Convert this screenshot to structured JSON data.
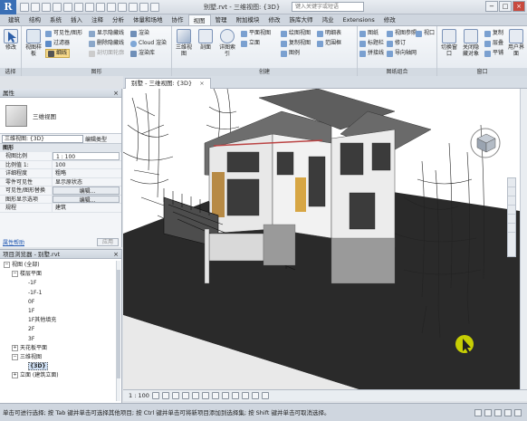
{
  "titlebar": {
    "logo": "R",
    "document_title": "别墅.rvt - 三维视图: {3D}",
    "search_placeholder": "键入关键字或短语",
    "minimize": "−",
    "maximize": "□",
    "close": "×"
  },
  "ribbon_tabs": [
    "建筑",
    "结构",
    "系统",
    "插入",
    "注释",
    "分析",
    "体量和场地",
    "协作",
    "视图",
    "管理",
    "附加模块",
    "修改",
    "族库大师",
    "鸿业",
    "Extensions",
    "修改"
  ],
  "active_tab_index": 8,
  "ribbon": {
    "groups": {
      "select": "选择",
      "graphics": "图形",
      "create": "创建",
      "sheet_composition": "图纸组合",
      "windows": "窗口"
    },
    "buttons": {
      "modify": "修改",
      "view_templates": "视图样板",
      "visibility_graphics": "可见性/图形",
      "filters": "过滤器",
      "thin_lines": "细线",
      "show_hidden": "显示隐藏线",
      "remove_hidden": "删除隐藏线",
      "cut_profile": "剖切面轮廓",
      "render": "渲染",
      "cloud_render": "Cloud 渲染",
      "render_gallery": "渲染库",
      "3d_view": "三维视图",
      "section": "剖面",
      "callout": "详图索引",
      "plan_views": "平面视图",
      "elevation": "立面",
      "drafting_view": "绘图视图",
      "duplicate_view": "复制视图",
      "legends": "图例",
      "schedules": "明细表",
      "scope_box": "范围框",
      "sheet": "图纸",
      "title_block": "标题栏",
      "matchline": "拼接线",
      "view_reference": "视图参照",
      "guide_grid": "导向轴网",
      "revisions": "修订",
      "viewports": "视口",
      "switch_windows": "切换窗口",
      "close_hidden": "关闭隐藏对象",
      "replicate": "复制",
      "cascade": "层叠",
      "tile": "平铺",
      "user_interface": "用户界面"
    }
  },
  "properties": {
    "title": "属性",
    "type_name": "三维视图",
    "view_selector": "三维视图: {3D}",
    "edit_type": "编辑类型",
    "category": "图形",
    "rows": [
      {
        "key": "视图比例",
        "value": "1 : 100",
        "style": "box"
      },
      {
        "key": "比例值 1:",
        "value": "100",
        "style": "plain"
      },
      {
        "key": "详细程度",
        "value": "粗略",
        "style": "plain"
      },
      {
        "key": "零件可见性",
        "value": "显示原状态",
        "style": "plain"
      },
      {
        "key": "可见性/图形替换",
        "value": "编辑...",
        "style": "btn"
      },
      {
        "key": "图形显示选项",
        "value": "编辑...",
        "style": "btn"
      },
      {
        "key": "规程",
        "value": "建筑",
        "style": "plain"
      }
    ],
    "help_link": "属性帮助",
    "apply": "应用"
  },
  "project_browser": {
    "title": "项目浏览器 - 别墅.rvt",
    "items": [
      {
        "label": "视图 (全部)",
        "indent": 0,
        "toggle": "−"
      },
      {
        "label": "楼层平面",
        "indent": 1,
        "toggle": "−"
      },
      {
        "label": "-1F",
        "indent": 2,
        "toggle": ""
      },
      {
        "label": "-1F-1",
        "indent": 2,
        "toggle": ""
      },
      {
        "label": "0F",
        "indent": 2,
        "toggle": ""
      },
      {
        "label": "1F",
        "indent": 2,
        "toggle": ""
      },
      {
        "label": "1F其他填充",
        "indent": 2,
        "toggle": ""
      },
      {
        "label": "2F",
        "indent": 2,
        "toggle": ""
      },
      {
        "label": "3F",
        "indent": 2,
        "toggle": ""
      },
      {
        "label": "天花板平面",
        "indent": 1,
        "toggle": "+"
      },
      {
        "label": "三维视图",
        "indent": 1,
        "toggle": "−"
      },
      {
        "label": "{3D}",
        "indent": 2,
        "toggle": "",
        "selected": true
      },
      {
        "label": "立面 (建筑立面)",
        "indent": 1,
        "toggle": "+"
      }
    ]
  },
  "view_tab": {
    "label": "别墅 - 三维视图: {3D}",
    "close": "×"
  },
  "viewbar": {
    "scale": "1 : 100"
  },
  "statusbar": {
    "message": "单击可进行选择; 按 Tab 键并单击可选择其他项目; 按 Ctrl 键并单击可将新项目添加到选择集; 按 Shift 键并单击可取消选择。"
  },
  "colors": {
    "accent": "#3a6fb5",
    "cursor_marker": "#d8e000"
  }
}
